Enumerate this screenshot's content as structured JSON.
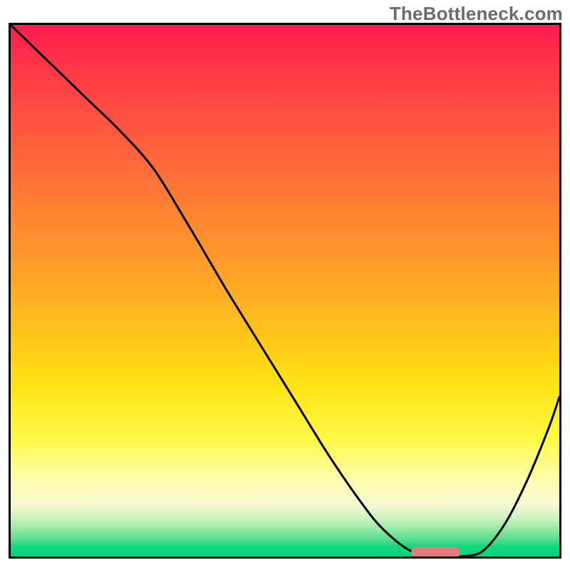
{
  "watermark": "TheBottleneck.com",
  "chart_data": {
    "type": "line",
    "title": "",
    "xlabel": "",
    "ylabel": "",
    "xlim": [
      0,
      100
    ],
    "ylim": [
      0,
      100
    ],
    "grid": false,
    "legend": false,
    "series": [
      {
        "name": "bottleneck-curve",
        "x": [
          0,
          8,
          14,
          20,
          26,
          32,
          36,
          40,
          46,
          52,
          58,
          64,
          68,
          73,
          78,
          82,
          86,
          90,
          94,
          98,
          100
        ],
        "values": [
          100,
          92,
          86,
          80,
          73,
          63,
          56,
          49,
          39,
          29,
          19,
          10,
          5,
          1,
          0,
          0,
          1,
          6,
          14,
          24,
          30
        ]
      }
    ],
    "optimal_marker": {
      "x_start": 73,
      "x_end": 82,
      "y": 0.8
    },
    "background_gradient": {
      "stops": [
        {
          "pos": 0,
          "color": "#ff1a4f"
        },
        {
          "pos": 50,
          "color": "#ffb022"
        },
        {
          "pos": 80,
          "color": "#fff962"
        },
        {
          "pos": 100,
          "color": "#00d27b"
        }
      ]
    }
  }
}
